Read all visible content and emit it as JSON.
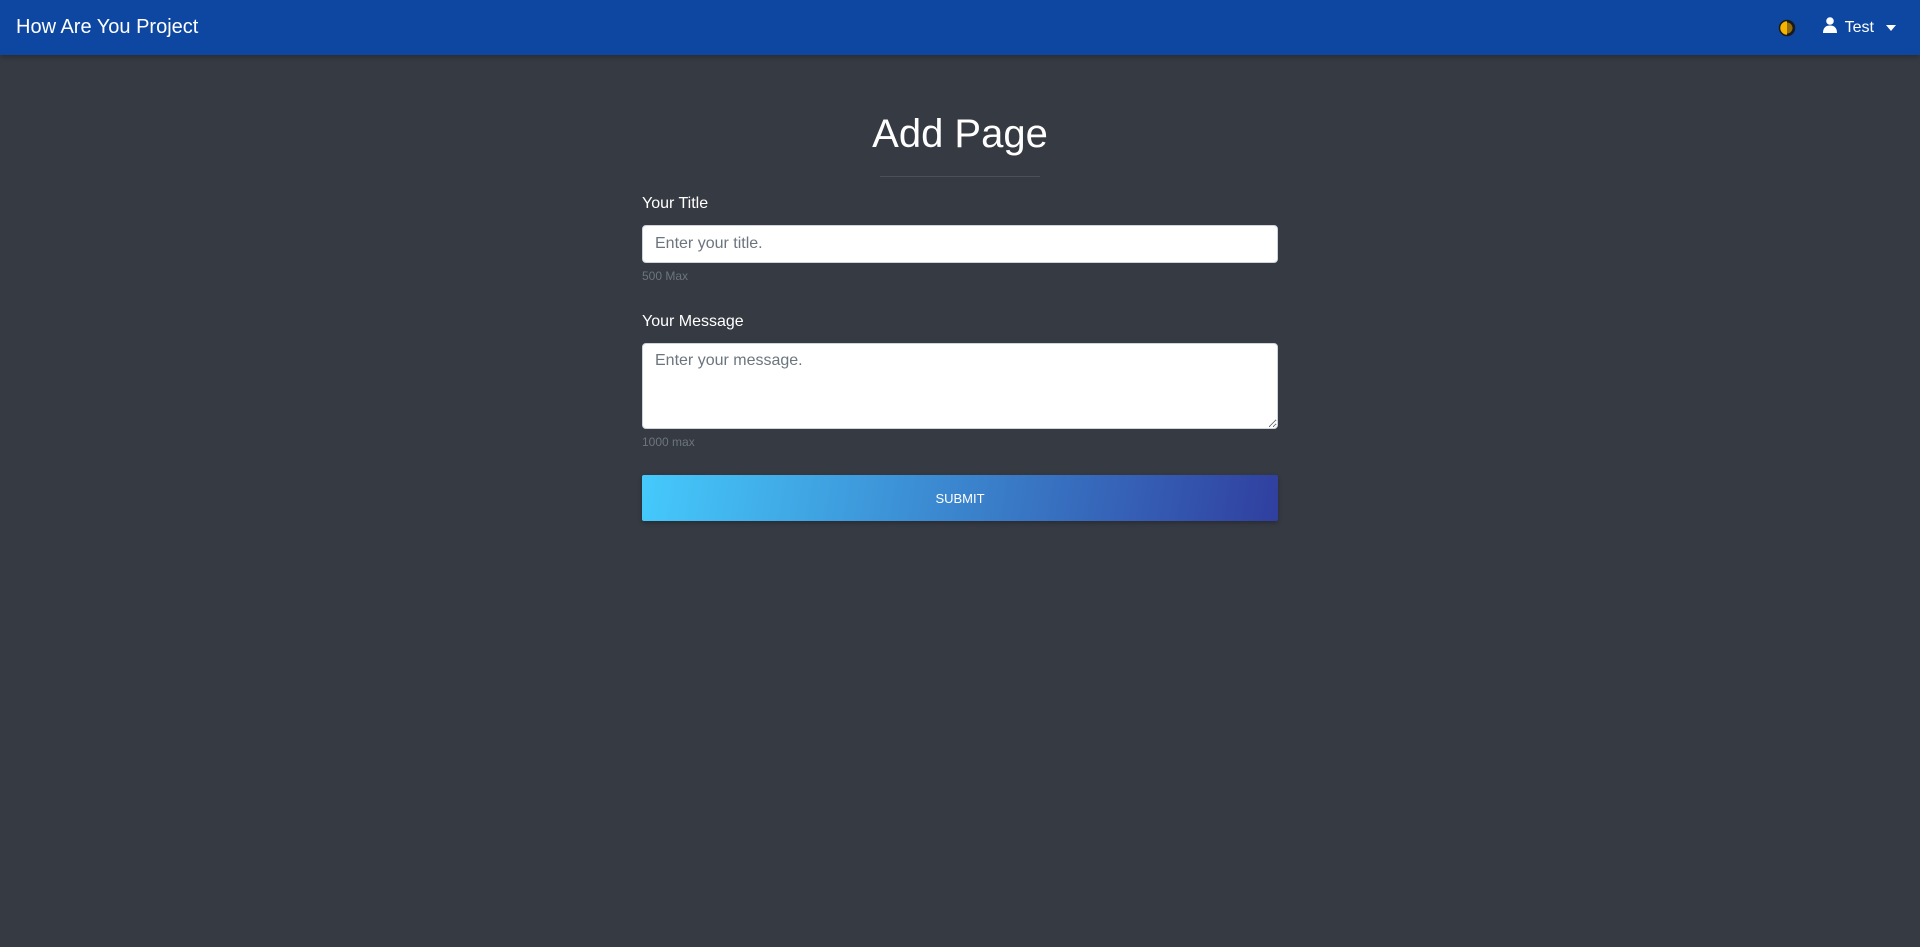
{
  "navbar": {
    "brand": "How Are You Project",
    "user_name": "Test",
    "theme_icon": "half-moon-theme-icon",
    "user_icon": "user-icon",
    "caret_icon": "caret-down-icon"
  },
  "main": {
    "heading": "Add Page",
    "title_field": {
      "label": "Your Title",
      "placeholder": "Enter your title.",
      "value": "",
      "help": "500 Max"
    },
    "message_field": {
      "label": "Your Message",
      "placeholder": "Enter your message.",
      "value": "",
      "help": "1000 max"
    },
    "submit_label": "Submit"
  },
  "colors": {
    "navbar": "#0d47a1",
    "background": "#363a42",
    "button_gradient_start": "#45cafc",
    "button_gradient_end": "#303f9f",
    "theme_toggle_accent": "#f4b400"
  }
}
